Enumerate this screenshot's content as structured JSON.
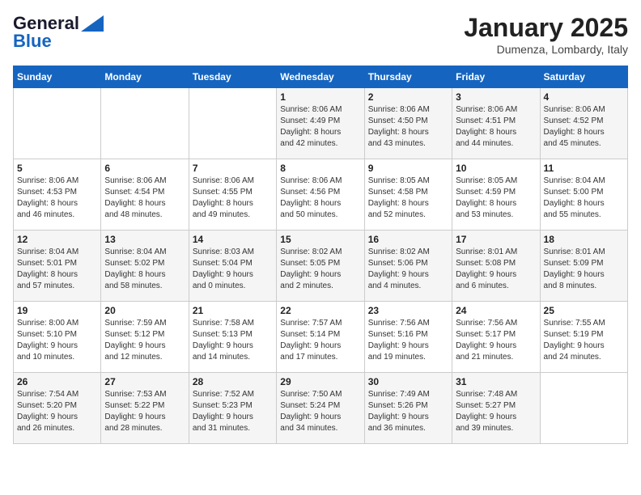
{
  "header": {
    "logo_general": "General",
    "logo_blue": "Blue",
    "month": "January 2025",
    "location": "Dumenza, Lombardy, Italy"
  },
  "days_of_week": [
    "Sunday",
    "Monday",
    "Tuesday",
    "Wednesday",
    "Thursday",
    "Friday",
    "Saturday"
  ],
  "weeks": [
    [
      {
        "day": "",
        "info": ""
      },
      {
        "day": "",
        "info": ""
      },
      {
        "day": "",
        "info": ""
      },
      {
        "day": "1",
        "info": "Sunrise: 8:06 AM\nSunset: 4:49 PM\nDaylight: 8 hours\nand 42 minutes."
      },
      {
        "day": "2",
        "info": "Sunrise: 8:06 AM\nSunset: 4:50 PM\nDaylight: 8 hours\nand 43 minutes."
      },
      {
        "day": "3",
        "info": "Sunrise: 8:06 AM\nSunset: 4:51 PM\nDaylight: 8 hours\nand 44 minutes."
      },
      {
        "day": "4",
        "info": "Sunrise: 8:06 AM\nSunset: 4:52 PM\nDaylight: 8 hours\nand 45 minutes."
      }
    ],
    [
      {
        "day": "5",
        "info": "Sunrise: 8:06 AM\nSunset: 4:53 PM\nDaylight: 8 hours\nand 46 minutes."
      },
      {
        "day": "6",
        "info": "Sunrise: 8:06 AM\nSunset: 4:54 PM\nDaylight: 8 hours\nand 48 minutes."
      },
      {
        "day": "7",
        "info": "Sunrise: 8:06 AM\nSunset: 4:55 PM\nDaylight: 8 hours\nand 49 minutes."
      },
      {
        "day": "8",
        "info": "Sunrise: 8:06 AM\nSunset: 4:56 PM\nDaylight: 8 hours\nand 50 minutes."
      },
      {
        "day": "9",
        "info": "Sunrise: 8:05 AM\nSunset: 4:58 PM\nDaylight: 8 hours\nand 52 minutes."
      },
      {
        "day": "10",
        "info": "Sunrise: 8:05 AM\nSunset: 4:59 PM\nDaylight: 8 hours\nand 53 minutes."
      },
      {
        "day": "11",
        "info": "Sunrise: 8:04 AM\nSunset: 5:00 PM\nDaylight: 8 hours\nand 55 minutes."
      }
    ],
    [
      {
        "day": "12",
        "info": "Sunrise: 8:04 AM\nSunset: 5:01 PM\nDaylight: 8 hours\nand 57 minutes."
      },
      {
        "day": "13",
        "info": "Sunrise: 8:04 AM\nSunset: 5:02 PM\nDaylight: 8 hours\nand 58 minutes."
      },
      {
        "day": "14",
        "info": "Sunrise: 8:03 AM\nSunset: 5:04 PM\nDaylight: 9 hours\nand 0 minutes."
      },
      {
        "day": "15",
        "info": "Sunrise: 8:02 AM\nSunset: 5:05 PM\nDaylight: 9 hours\nand 2 minutes."
      },
      {
        "day": "16",
        "info": "Sunrise: 8:02 AM\nSunset: 5:06 PM\nDaylight: 9 hours\nand 4 minutes."
      },
      {
        "day": "17",
        "info": "Sunrise: 8:01 AM\nSunset: 5:08 PM\nDaylight: 9 hours\nand 6 minutes."
      },
      {
        "day": "18",
        "info": "Sunrise: 8:01 AM\nSunset: 5:09 PM\nDaylight: 9 hours\nand 8 minutes."
      }
    ],
    [
      {
        "day": "19",
        "info": "Sunrise: 8:00 AM\nSunset: 5:10 PM\nDaylight: 9 hours\nand 10 minutes."
      },
      {
        "day": "20",
        "info": "Sunrise: 7:59 AM\nSunset: 5:12 PM\nDaylight: 9 hours\nand 12 minutes."
      },
      {
        "day": "21",
        "info": "Sunrise: 7:58 AM\nSunset: 5:13 PM\nDaylight: 9 hours\nand 14 minutes."
      },
      {
        "day": "22",
        "info": "Sunrise: 7:57 AM\nSunset: 5:14 PM\nDaylight: 9 hours\nand 17 minutes."
      },
      {
        "day": "23",
        "info": "Sunrise: 7:56 AM\nSunset: 5:16 PM\nDaylight: 9 hours\nand 19 minutes."
      },
      {
        "day": "24",
        "info": "Sunrise: 7:56 AM\nSunset: 5:17 PM\nDaylight: 9 hours\nand 21 minutes."
      },
      {
        "day": "25",
        "info": "Sunrise: 7:55 AM\nSunset: 5:19 PM\nDaylight: 9 hours\nand 24 minutes."
      }
    ],
    [
      {
        "day": "26",
        "info": "Sunrise: 7:54 AM\nSunset: 5:20 PM\nDaylight: 9 hours\nand 26 minutes."
      },
      {
        "day": "27",
        "info": "Sunrise: 7:53 AM\nSunset: 5:22 PM\nDaylight: 9 hours\nand 28 minutes."
      },
      {
        "day": "28",
        "info": "Sunrise: 7:52 AM\nSunset: 5:23 PM\nDaylight: 9 hours\nand 31 minutes."
      },
      {
        "day": "29",
        "info": "Sunrise: 7:50 AM\nSunset: 5:24 PM\nDaylight: 9 hours\nand 34 minutes."
      },
      {
        "day": "30",
        "info": "Sunrise: 7:49 AM\nSunset: 5:26 PM\nDaylight: 9 hours\nand 36 minutes."
      },
      {
        "day": "31",
        "info": "Sunrise: 7:48 AM\nSunset: 5:27 PM\nDaylight: 9 hours\nand 39 minutes."
      },
      {
        "day": "",
        "info": ""
      }
    ]
  ]
}
